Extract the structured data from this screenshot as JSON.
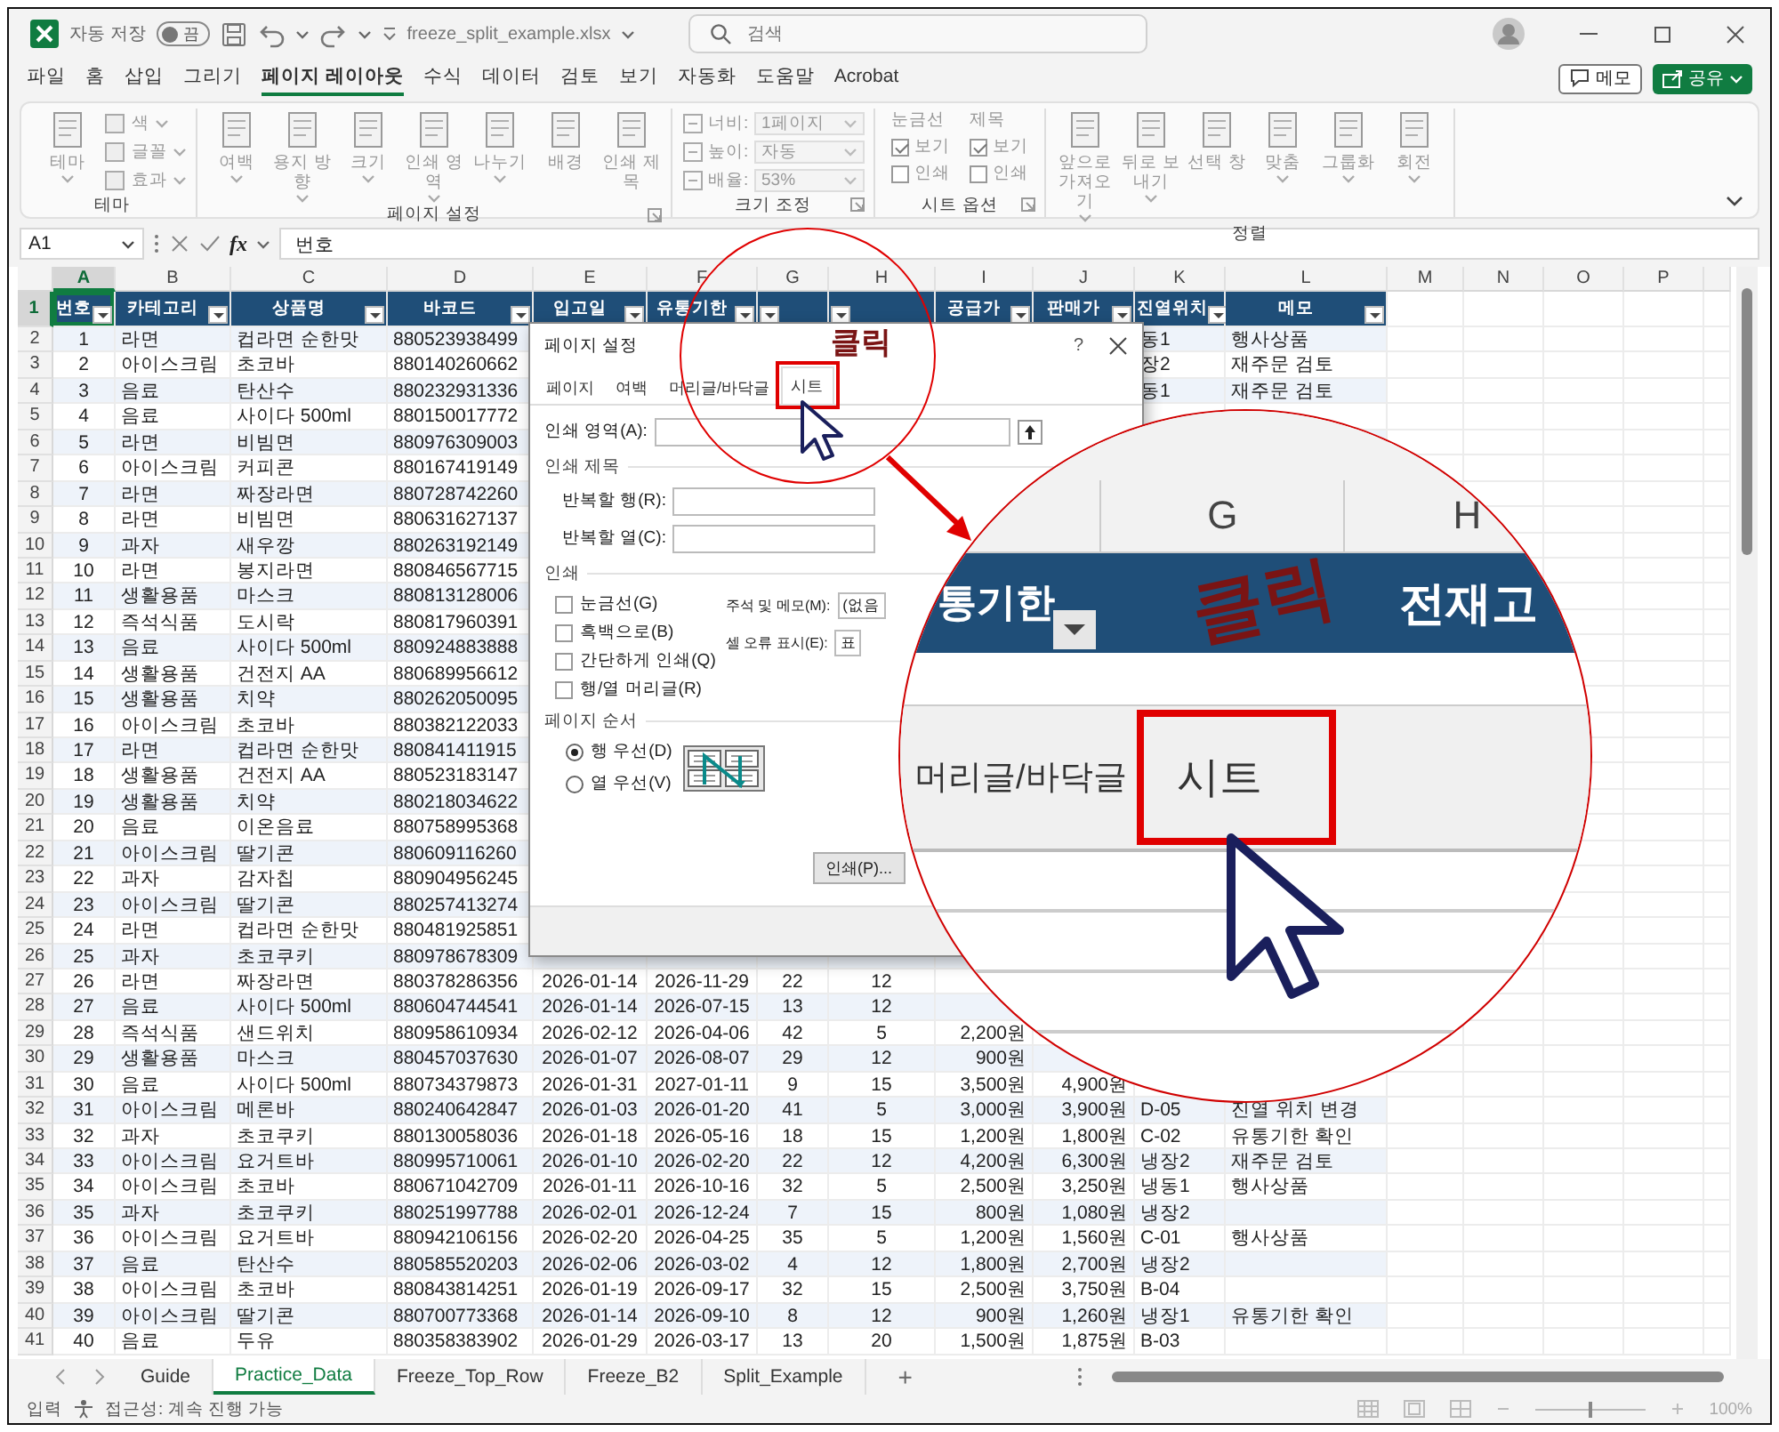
{
  "title_bar": {
    "autosave_label": "자동 저장",
    "autosave_toggle": "끔",
    "autosave_on": false,
    "file_name": "freeze_split_example.xlsx",
    "search_placeholder": "검색"
  },
  "menu_tabs": [
    {
      "label": "파일",
      "selected": false
    },
    {
      "label": "홈",
      "selected": false
    },
    {
      "label": "삽입",
      "selected": false
    },
    {
      "label": "그리기",
      "selected": false
    },
    {
      "label": "페이지 레이아웃",
      "selected": true
    },
    {
      "label": "수식",
      "selected": false
    },
    {
      "label": "데이터",
      "selected": false
    },
    {
      "label": "검토",
      "selected": false
    },
    {
      "label": "보기",
      "selected": false
    },
    {
      "label": "자동화",
      "selected": false
    },
    {
      "label": "도움말",
      "selected": false
    },
    {
      "label": "Acrobat",
      "selected": false
    }
  ],
  "menu_actions": [
    {
      "label": "메모",
      "kind": "outline"
    },
    {
      "label": "공유",
      "kind": "primary"
    }
  ],
  "ribbon_groups": [
    {
      "label": "테마",
      "launcher": false,
      "items": [
        {
          "kind": "large",
          "label": "테마",
          "dropdown": true
        },
        {
          "kind": "small",
          "label": "색",
          "dropdown": true
        },
        {
          "kind": "small",
          "label": "글꼴",
          "dropdown": true
        },
        {
          "kind": "small",
          "label": "효과",
          "dropdown": true
        }
      ]
    },
    {
      "label": "페이지 설정",
      "launcher": true,
      "items": [
        {
          "kind": "large",
          "label": "여백",
          "dropdown": true
        },
        {
          "kind": "large",
          "label": "용지 방향",
          "dropdown": true
        },
        {
          "kind": "large",
          "label": "크기",
          "dropdown": true
        },
        {
          "kind": "large",
          "label": "인쇄 영역",
          "dropdown": true
        },
        {
          "kind": "large",
          "label": "나누기",
          "dropdown": true
        },
        {
          "kind": "large",
          "label": "배경",
          "dropdown": false
        },
        {
          "kind": "large",
          "label": "인쇄 제목",
          "dropdown": false
        }
      ]
    },
    {
      "label": "크기 조정",
      "launcher": true,
      "items": [
        {
          "kind": "field",
          "label": "너비:",
          "value": "1페이지"
        },
        {
          "kind": "field",
          "label": "높이:",
          "value": "자동"
        },
        {
          "kind": "field",
          "label": "배율:",
          "value": "53%"
        }
      ]
    },
    {
      "label": "시트 옵션",
      "launcher": true,
      "items": [
        {
          "kind": "checks",
          "title": "눈금선",
          "checks": [
            {
              "label": "보기",
              "checked": true
            },
            {
              "label": "인쇄",
              "checked": false
            }
          ]
        },
        {
          "kind": "checks",
          "title": "제목",
          "checks": [
            {
              "label": "보기",
              "checked": true
            },
            {
              "label": "인쇄",
              "checked": false
            }
          ]
        }
      ]
    },
    {
      "label": "정렬",
      "launcher": false,
      "items": [
        {
          "kind": "large",
          "label": "앞으로 가져오기",
          "dropdown": true
        },
        {
          "kind": "large",
          "label": "뒤로 보내기",
          "dropdown": true
        },
        {
          "kind": "large",
          "label": "선택 창",
          "dropdown": false
        },
        {
          "kind": "large",
          "label": "맞춤",
          "dropdown": true
        },
        {
          "kind": "large",
          "label": "그룹화",
          "dropdown": true
        },
        {
          "kind": "large",
          "label": "회전",
          "dropdown": true
        }
      ]
    }
  ],
  "formula_bar": {
    "name_box": "A1",
    "fx": "fx",
    "content": "번호"
  },
  "sheet": {
    "columns": [
      {
        "letter": "A",
        "selected": true
      },
      {
        "letter": "B",
        "selected": false
      },
      {
        "letter": "C",
        "selected": false
      },
      {
        "letter": "D",
        "selected": false
      },
      {
        "letter": "E",
        "selected": false
      },
      {
        "letter": "F",
        "selected": false
      },
      {
        "letter": "G",
        "selected": false
      },
      {
        "letter": "H",
        "selected": false
      },
      {
        "letter": "I",
        "selected": false
      },
      {
        "letter": "J",
        "selected": false
      },
      {
        "letter": "K",
        "selected": false
      },
      {
        "letter": "L",
        "selected": false
      },
      {
        "letter": "M",
        "selected": false
      },
      {
        "letter": "N",
        "selected": false
      },
      {
        "letter": "O",
        "selected": false
      },
      {
        "letter": "P",
        "selected": false
      }
    ],
    "rows": [
      {
        "number": "1",
        "kind": "header",
        "selected": true,
        "cells": [
          "번호",
          "카테고리",
          "상품명",
          "바코드",
          "입고일",
          "유통기한",
          null,
          null,
          "공급가",
          "판매가",
          "진열위치",
          "메모"
        ]
      },
      {
        "number": "2",
        "kind": "data",
        "selected": false,
        "cells": [
          "1",
          "라면",
          "컵라면 순한맛",
          "880523938499",
          null,
          null,
          null,
          null,
          null,
          null,
          "동1",
          "행사상품"
        ]
      },
      {
        "number": "3",
        "kind": "data",
        "selected": false,
        "cells": [
          "2",
          "아이스크림",
          "초코바",
          "880140260662",
          null,
          null,
          null,
          null,
          null,
          null,
          "장2",
          "재주문 검토"
        ]
      },
      {
        "number": "4",
        "kind": "data",
        "selected": false,
        "cells": [
          "3",
          "음료",
          "탄산수",
          "880232931336",
          null,
          null,
          null,
          null,
          null,
          null,
          "동1",
          "재주문 검토"
        ]
      },
      {
        "number": "5",
        "kind": "data",
        "selected": false,
        "cells": [
          "4",
          "음료",
          "사이다 500ml",
          "880150017772"
        ]
      },
      {
        "number": "6",
        "kind": "data",
        "selected": false,
        "cells": [
          "5",
          "라면",
          "비빔면",
          "880976309003"
        ]
      },
      {
        "number": "7",
        "kind": "data",
        "selected": false,
        "cells": [
          "6",
          "아이스크림",
          "커피콘",
          "880167419149"
        ]
      },
      {
        "number": "8",
        "kind": "data",
        "selected": false,
        "cells": [
          "7",
          "라면",
          "짜장라면",
          "880728742260"
        ]
      },
      {
        "number": "9",
        "kind": "data",
        "selected": false,
        "cells": [
          "8",
          "라면",
          "비빔면",
          "880631627137"
        ]
      },
      {
        "number": "10",
        "kind": "data",
        "selected": false,
        "cells": [
          "9",
          "과자",
          "새우깡",
          "880263192149"
        ]
      },
      {
        "number": "11",
        "kind": "data",
        "selected": false,
        "cells": [
          "10",
          "라면",
          "봉지라면",
          "880846567715"
        ]
      },
      {
        "number": "12",
        "kind": "data",
        "selected": false,
        "cells": [
          "11",
          "생활용품",
          "마스크",
          "880813128006"
        ]
      },
      {
        "number": "13",
        "kind": "data",
        "selected": false,
        "cells": [
          "12",
          "즉석식품",
          "도시락",
          "880817960391"
        ]
      },
      {
        "number": "14",
        "kind": "data",
        "selected": false,
        "cells": [
          "13",
          "음료",
          "사이다 500ml",
          "880924883888"
        ]
      },
      {
        "number": "15",
        "kind": "data",
        "selected": false,
        "cells": [
          "14",
          "생활용품",
          "건전지 AA",
          "880689956612"
        ]
      },
      {
        "number": "16",
        "kind": "data",
        "selected": false,
        "cells": [
          "15",
          "생활용품",
          "치약",
          "880262050095"
        ]
      },
      {
        "number": "17",
        "kind": "data",
        "selected": false,
        "cells": [
          "16",
          "아이스크림",
          "초코바",
          "880382122033"
        ]
      },
      {
        "number": "18",
        "kind": "data",
        "selected": false,
        "cells": [
          "17",
          "라면",
          "컵라면 순한맛",
          "880841411915"
        ]
      },
      {
        "number": "19",
        "kind": "data",
        "selected": false,
        "cells": [
          "18",
          "생활용품",
          "건전지 AA",
          "880523183147"
        ]
      },
      {
        "number": "20",
        "kind": "data",
        "selected": false,
        "cells": [
          "19",
          "생활용품",
          "치약",
          "880218034622"
        ]
      },
      {
        "number": "21",
        "kind": "data",
        "selected": false,
        "cells": [
          "20",
          "음료",
          "이온음료",
          "880758995368"
        ]
      },
      {
        "number": "22",
        "kind": "data",
        "selected": false,
        "cells": [
          "21",
          "아이스크림",
          "딸기콘",
          "880609116260"
        ]
      },
      {
        "number": "23",
        "kind": "data",
        "selected": false,
        "cells": [
          "22",
          "과자",
          "감자칩",
          "880904956245"
        ]
      },
      {
        "number": "24",
        "kind": "data",
        "selected": false,
        "cells": [
          "23",
          "아이스크림",
          "딸기콘",
          "880257413274"
        ]
      },
      {
        "number": "25",
        "kind": "data",
        "selected": false,
        "cells": [
          "24",
          "라면",
          "컵라면 순한맛",
          "880481925851"
        ]
      },
      {
        "number": "26",
        "kind": "data",
        "selected": false,
        "cells": [
          "25",
          "과자",
          "초코쿠키",
          "880978678309"
        ]
      },
      {
        "number": "27",
        "kind": "data",
        "selected": false,
        "cells": [
          "26",
          "라면",
          "짜장라면",
          "880378286356",
          "2026-01-14",
          "2026-11-29",
          "22",
          "12"
        ]
      },
      {
        "number": "28",
        "kind": "data",
        "selected": false,
        "cells": [
          "27",
          "음료",
          "사이다 500ml",
          "880604744541",
          "2026-01-14",
          "2026-07-15",
          "13",
          "12"
        ]
      },
      {
        "number": "29",
        "kind": "data",
        "selected": false,
        "cells": [
          "28",
          "즉석식품",
          "샌드위치",
          "880958610934",
          "2026-02-12",
          "2026-04-06",
          "42",
          "5",
          "2,200원"
        ]
      },
      {
        "number": "30",
        "kind": "data",
        "selected": false,
        "cells": [
          "29",
          "생활용품",
          "마스크",
          "880457037630",
          "2026-01-07",
          "2026-08-07",
          "29",
          "12",
          "900원"
        ]
      },
      {
        "number": "31",
        "kind": "data",
        "selected": false,
        "cells": [
          "30",
          "음료",
          "사이다 500ml",
          "880734379873",
          "2026-01-31",
          "2027-01-11",
          "9",
          "15",
          "3,500원",
          "4,900원"
        ]
      },
      {
        "number": "32",
        "kind": "data",
        "selected": false,
        "cells": [
          "31",
          "아이스크림",
          "메론바",
          "880240642847",
          "2026-01-03",
          "2026-01-20",
          "41",
          "5",
          "3,000원",
          "3,900원",
          "D-05",
          "진열 위치 변경"
        ]
      },
      {
        "number": "33",
        "kind": "data",
        "selected": false,
        "cells": [
          "32",
          "과자",
          "초코쿠키",
          "880130058036",
          "2026-01-18",
          "2026-05-16",
          "18",
          "15",
          "1,200원",
          "1,800원",
          "C-02",
          "유통기한 확인"
        ]
      },
      {
        "number": "34",
        "kind": "data",
        "selected": false,
        "cells": [
          "33",
          "아이스크림",
          "요거트바",
          "880995710061",
          "2026-01-10",
          "2026-02-20",
          "22",
          "12",
          "4,200원",
          "6,300원",
          "냉장2",
          "재주문 검토"
        ]
      },
      {
        "number": "35",
        "kind": "data",
        "selected": false,
        "cells": [
          "34",
          "아이스크림",
          "초코바",
          "880671042709",
          "2026-01-11",
          "2026-10-16",
          "32",
          "5",
          "2,500원",
          "3,250원",
          "냉동1",
          "행사상품"
        ]
      },
      {
        "number": "36",
        "kind": "data",
        "selected": false,
        "cells": [
          "35",
          "과자",
          "초코쿠키",
          "880251997788",
          "2026-02-01",
          "2026-12-24",
          "7",
          "15",
          "800원",
          "1,080원",
          "냉장2"
        ]
      },
      {
        "number": "37",
        "kind": "data",
        "selected": false,
        "cells": [
          "36",
          "아이스크림",
          "요거트바",
          "880942106156",
          "2026-02-20",
          "2026-04-25",
          "35",
          "5",
          "1,200원",
          "1,560원",
          "C-01",
          "행사상품"
        ]
      },
      {
        "number": "38",
        "kind": "data",
        "selected": false,
        "cells": [
          "37",
          "음료",
          "탄산수",
          "880585520203",
          "2026-02-06",
          "2026-03-02",
          "4",
          "12",
          "1,800원",
          "2,700원",
          "냉장2"
        ]
      },
      {
        "number": "39",
        "kind": "data",
        "selected": false,
        "cells": [
          "38",
          "아이스크림",
          "초코바",
          "880843814251",
          "2026-01-19",
          "2026-09-17",
          "32",
          "15",
          "2,500원",
          "3,750원",
          "B-04"
        ]
      },
      {
        "number": "40",
        "kind": "data",
        "selected": false,
        "cells": [
          "39",
          "아이스크림",
          "딸기콘",
          "880700773368",
          "2026-01-14",
          "2026-09-10",
          "8",
          "12",
          "900원",
          "1,260원",
          "냉장1",
          "유통기한 확인"
        ]
      },
      {
        "number": "41",
        "kind": "data",
        "selected": false,
        "cells": [
          "40",
          "음료",
          "두유",
          "880358383902",
          "2026-01-29",
          "2026-03-17",
          "13",
          "20",
          "1,500원",
          "1,875원",
          "B-03"
        ]
      }
    ]
  },
  "dialog": {
    "title": "페이지 설정",
    "help": "?",
    "tabs": [
      {
        "label": "페이지",
        "selected": false,
        "highlighted": false
      },
      {
        "label": "여백",
        "selected": false,
        "highlighted": false
      },
      {
        "label": "머리글/바닥글",
        "selected": false,
        "highlighted": false
      },
      {
        "label": "시트",
        "selected": true,
        "highlighted": true
      }
    ],
    "print_area_label": "인쇄 영역(A):",
    "print_titles": {
      "title": "인쇄 제목",
      "fields": [
        "반복할 행(R):",
        "반복할 열(C):"
      ]
    },
    "print": {
      "title": "인쇄",
      "checks": [
        {
          "label": "눈금선(G)",
          "checked": false
        },
        {
          "label": "흑백으로(B)",
          "checked": false
        },
        {
          "label": "간단하게 인쇄(Q)",
          "checked": false
        },
        {
          "label": "행/열 머리글(R)",
          "checked": false
        }
      ],
      "combos": [
        {
          "label": "주석 및 메모(M):",
          "value": "(없음"
        },
        {
          "label": "셀 오류 표시(E):",
          "value": "표"
        }
      ]
    },
    "page_order": {
      "title": "페이지 순서",
      "options": [
        {
          "label": "행 우선(D)",
          "selected": true
        },
        {
          "label": "열 우선(V)",
          "selected": false
        }
      ]
    },
    "buttons": [
      "인쇄(P)..."
    ]
  },
  "magnifier": {
    "column_letters": [
      "G",
      "H"
    ],
    "headers": [
      "통기한",
      "전재고"
    ],
    "tabs": [
      {
        "label": "머리글/바닥글",
        "highlighted": false
      },
      {
        "label": "시트",
        "highlighted": true
      }
    ]
  },
  "click_labels": [
    "클릭",
    "클릭"
  ],
  "sheet_tabs": [
    {
      "label": "Guide",
      "selected": false
    },
    {
      "label": "Practice_Data",
      "selected": true
    },
    {
      "label": "Freeze_Top_Row",
      "selected": false
    },
    {
      "label": "Freeze_B2",
      "selected": false
    },
    {
      "label": "Split_Example",
      "selected": false
    }
  ],
  "add_sheet": "+",
  "status_bar": {
    "mode": "입력",
    "accessibility": "접근성: 계속 진행 가능",
    "zoom": "100%",
    "zoom_slider": {
      "level": 0.5
    }
  }
}
